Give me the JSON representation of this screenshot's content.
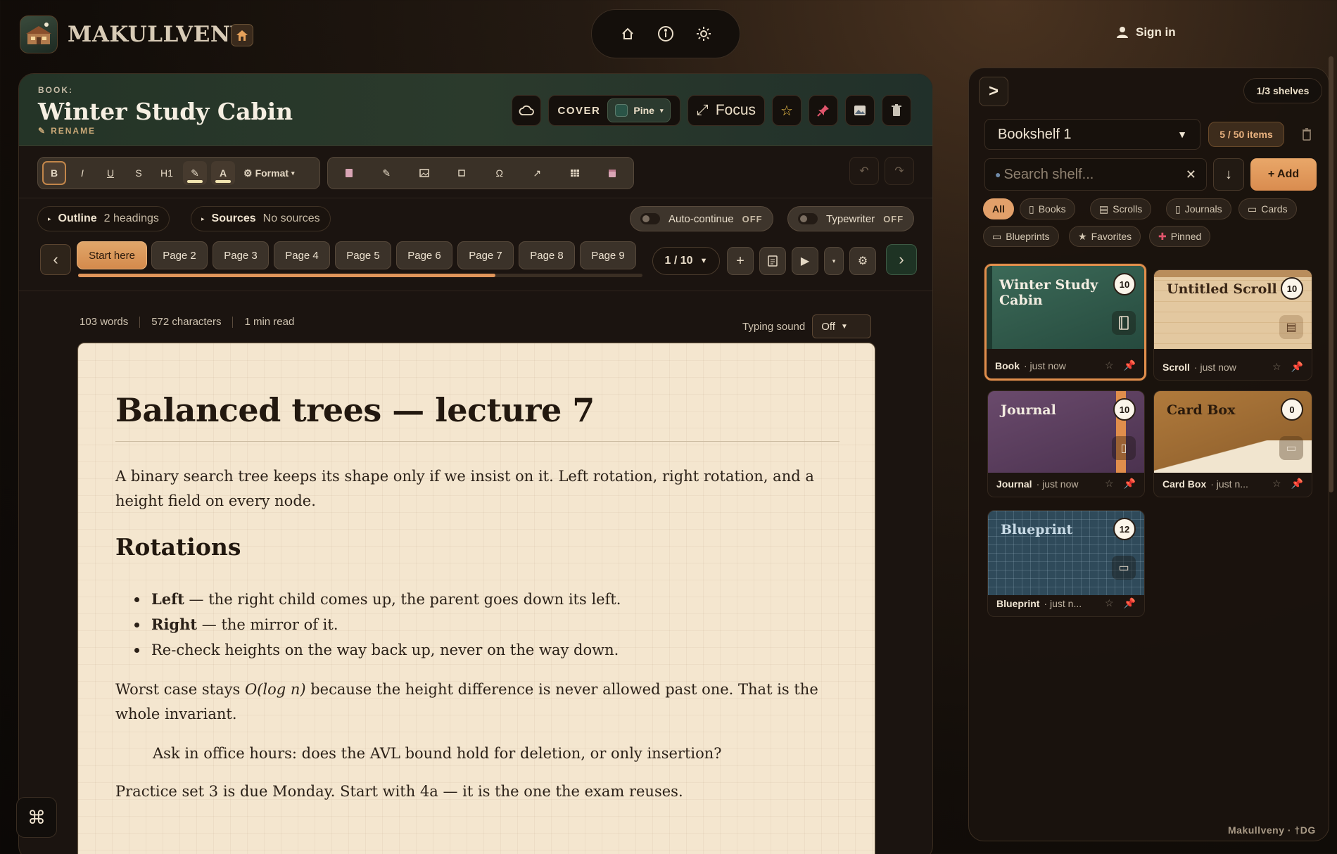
{
  "brand": {
    "name": "MAKULLVENY"
  },
  "topnav": {
    "items": [
      "home-icon",
      "info-icon",
      "settings-icon"
    ]
  },
  "signin": {
    "label": "Sign in"
  },
  "editor": {
    "kind": "BOOK:",
    "title": "Winter Study Cabin",
    "rename": "RENAME",
    "cover_label": "COVER",
    "cover_value": "Pine",
    "focus_label": "Focus",
    "toolbar": {
      "bold": "B",
      "italic": "I",
      "underline": "U",
      "strike": "S",
      "h1": "H1",
      "color": "A",
      "format": "Format"
    },
    "outline": {
      "label": "Outline",
      "value": "2 headings"
    },
    "sources": {
      "label": "Sources",
      "value": "No sources"
    },
    "autocontinue": {
      "label": "Auto-continue",
      "state": "OFF"
    },
    "typewriter": {
      "label": "Typewriter",
      "state": "OFF"
    },
    "pages": [
      "Start here",
      "Page 2",
      "Page 3",
      "Page 4",
      "Page 5",
      "Page 6",
      "Page 7",
      "Page 8",
      "Page 9"
    ],
    "progress": 0.74,
    "page_indicator": "1 / 10",
    "stats": {
      "words": "103 words",
      "chars": "572 characters",
      "read": "1 min read"
    },
    "typing_sound": {
      "label": "Typing sound",
      "value": "Off"
    }
  },
  "document": {
    "h1": "Balanced trees — lecture 7",
    "p1": "A binary search tree keeps its shape only if we insist on it. Left rotation, right rotation, and a height field on every node.",
    "h2": "Rotations",
    "bullets": [
      {
        "bold": "Left",
        "rest": " — the right child comes up, the parent goes down its left."
      },
      {
        "bold": "Right",
        "rest": " — the mirror of it."
      },
      {
        "bold": "",
        "rest": "Re-check heights on the way back up, never on the way down."
      }
    ],
    "p2_before": "Worst case stays ",
    "p2_em": "O(log n)",
    "p2_after": " because the height difference is never allowed past one. That is the whole invariant.",
    "quote": "Ask in office hours: does the AVL bound hold for deletion, or only insertion?",
    "p3": "Practice set 3 is due Monday. Start with 4a — it is the one the exam reuses."
  },
  "cmd": {
    "glyph": "⌘"
  },
  "shelf": {
    "collapse": ">",
    "shelves_count": "1/3 shelves",
    "bookshelf": "Bookshelf 1",
    "items_count": "5 / 50 items",
    "search_placeholder": "Search shelf...",
    "add_label": "+ Add",
    "filters": [
      "All",
      "Books",
      "Scrolls",
      "Journals",
      "Cards",
      "Blueprints",
      "Favorites",
      "Pinned"
    ],
    "cards": [
      {
        "title": "Winter Study Cabin",
        "count": "10",
        "type": "Book",
        "time": "· just now",
        "icon": "book-icon"
      },
      {
        "title": "Untitled Scroll",
        "count": "10",
        "type": "Scroll",
        "time": "· just now",
        "icon": "scroll-icon"
      },
      {
        "title": "Journal",
        "count": "10",
        "type": "Journal",
        "time": "· just now",
        "icon": "journal-icon"
      },
      {
        "title": "Card Box",
        "count": "0",
        "type": "Card Box",
        "time": "· just n...",
        "icon": "cardbox-icon"
      },
      {
        "title": "Blueprint",
        "count": "12",
        "type": "Blueprint",
        "time": "· just n...",
        "icon": "blueprint-icon"
      }
    ],
    "footer": "Makullveny · †DG"
  },
  "colors": {
    "accent": "#e08e4c",
    "pine": "#2a5447",
    "paper": "#f4e6cf",
    "pin": "#e0556c"
  }
}
